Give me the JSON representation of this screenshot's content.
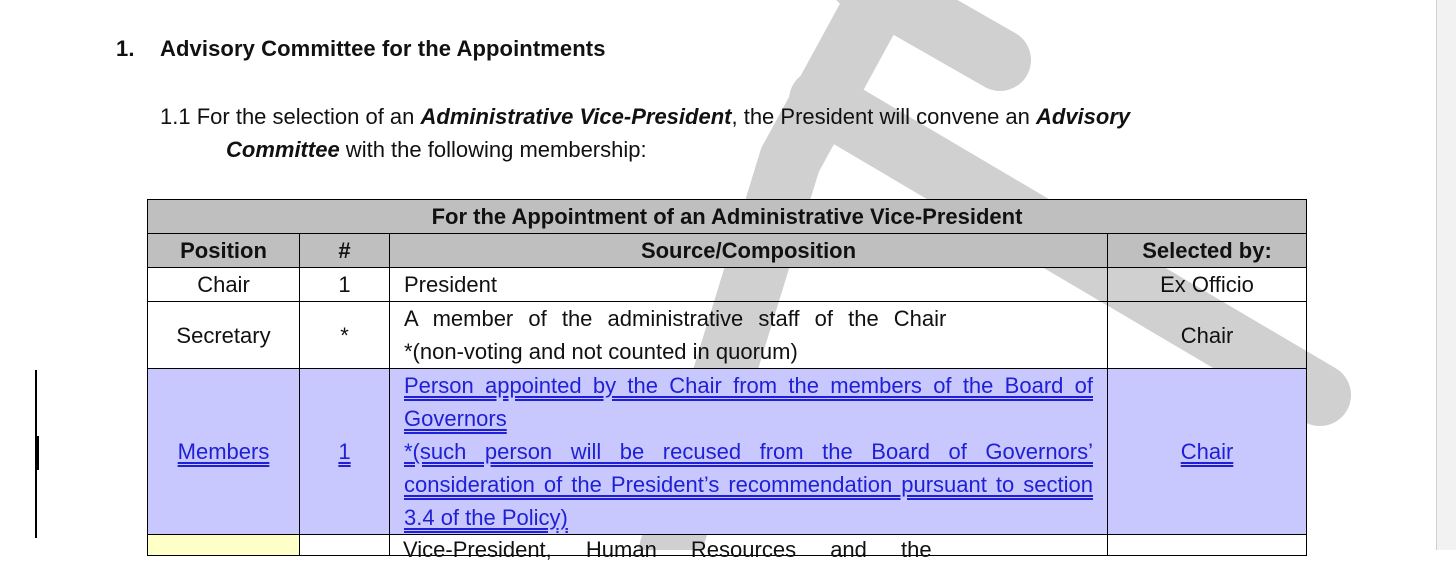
{
  "section": {
    "number": "1.",
    "title": "Advisory Committee for the Appointments"
  },
  "paragraph": {
    "number": "1.1",
    "text_before": "For the selection of an ",
    "term1": "Administrative Vice-President",
    "text_middle": ", the President will convene an ",
    "term2a": "Advisory",
    "term2b": "Committee",
    "text_after": " with the following membership:"
  },
  "table": {
    "title": "For the Appointment of an Administrative Vice-President",
    "headers": {
      "position": "Position",
      "number": "#",
      "source": "Source/Composition",
      "selected_by": "Selected by:"
    },
    "rows": [
      {
        "position": "Chair",
        "number": "1",
        "source_line1": "President",
        "source_line2": "",
        "selected_by": "Ex Officio"
      },
      {
        "position": "Secretary",
        "number": "*",
        "source_line1": "A member of the administrative staff of the Chair",
        "source_line2": "*(non-voting and not counted in quorum)",
        "selected_by": "Chair"
      },
      {
        "position": "Members",
        "number": "1",
        "source_line1": "Person appointed by the Chair from the members of the Board of Governors",
        "source_line2": "*(such person will be recused from the Board of Governors’ consideration of the President’s recommendation pursuant to section 3.4 of the Policy)",
        "selected_by": "Chair"
      }
    ],
    "partial_row_text": "Vice-President, Human Resources and the"
  },
  "colors": {
    "header_bg": "#bfbfbf",
    "highlight_row_bg": "#c8c8ff",
    "link_color": "#1f1fd6",
    "partial_cell_bg": "#ffffc8",
    "watermark": "#d0d0d0"
  }
}
